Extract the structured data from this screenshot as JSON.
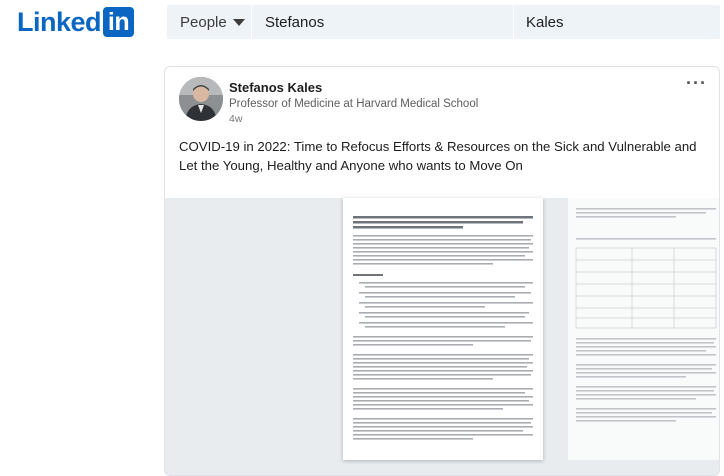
{
  "header": {
    "logo_word": "Linked",
    "logo_box": "in",
    "filter_label": "People",
    "first_name_value": "Stefanos",
    "last_name_value": "Kales"
  },
  "post": {
    "author_name": "Stefanos Kales",
    "author_headline": "Professor of Medicine at Harvard Medical School",
    "time_ago": "4w",
    "more_label": "···",
    "text": "COVID-19 in 2022: Time to Refocus Efforts & Resources on the Sick and Vulnerable and Let the Young, Healthy and Anyone who wants to Move On"
  },
  "colors": {
    "brand": "#0a66c2",
    "search_bg": "#eef3f8"
  },
  "icons": {
    "caret": "caret-down-icon",
    "more": "more-options-icon"
  }
}
